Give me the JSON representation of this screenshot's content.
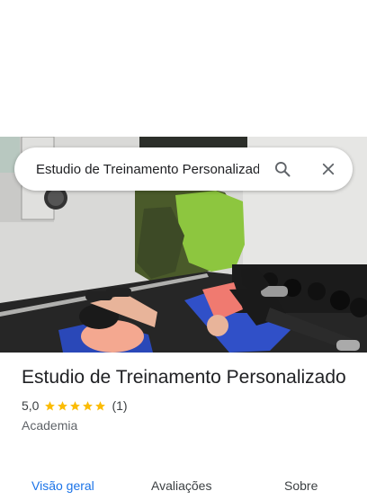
{
  "search": {
    "value": "Estudio de Treinamento Personalizado"
  },
  "place": {
    "title": "Estudio de Treinamento Personalizado",
    "rating": "5,0",
    "stars": 5,
    "review_count": "(1)",
    "category": "Academia"
  },
  "tabs": [
    {
      "label": "Visão geral",
      "active": true
    },
    {
      "label": "Avaliações",
      "active": false
    },
    {
      "label": "Sobre",
      "active": false
    }
  ],
  "icons": {
    "search": "search-icon",
    "close": "close-icon",
    "star": "star-icon"
  },
  "colors": {
    "accent": "#1a73e8",
    "star": "#fbbc04",
    "wall_green": "#8dc63f",
    "mat_blue": "#3050c8"
  }
}
